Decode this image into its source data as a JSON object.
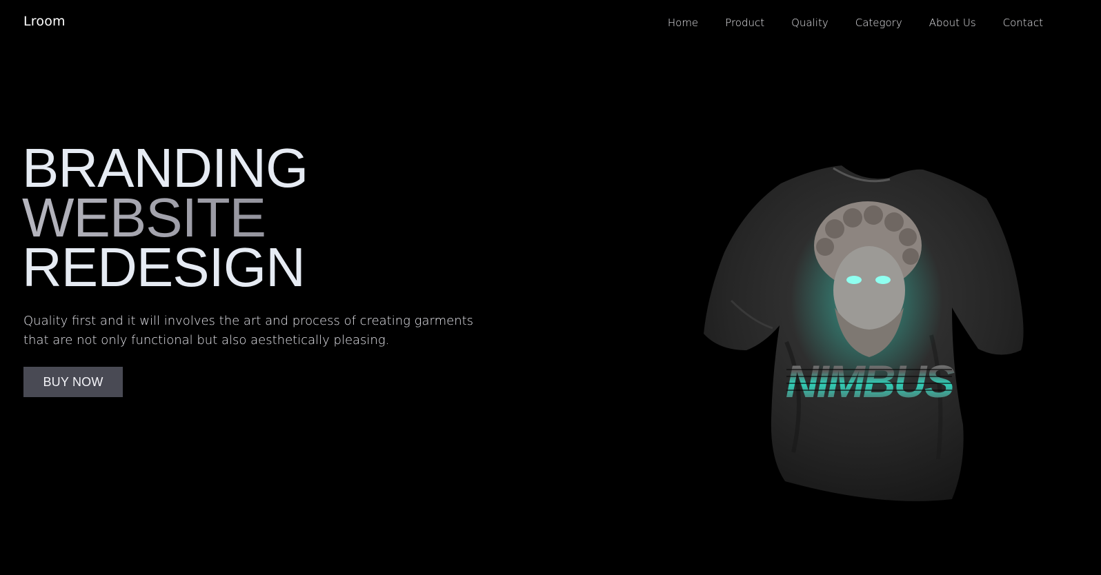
{
  "brand": {
    "logo_text": "Lroom"
  },
  "nav": {
    "items": [
      {
        "label": "Home"
      },
      {
        "label": "Product"
      },
      {
        "label": "Quality"
      },
      {
        "label": "Category"
      },
      {
        "label": "About Us"
      },
      {
        "label": "Contact"
      }
    ]
  },
  "hero": {
    "title_line1": "BRANDING",
    "title_line2": "WEBSITE",
    "title_line3": "REDESIGN",
    "description_line1": "Quality first and it will involves the art and process of creating garments",
    "description_line2": "that are not only functional but also aesthetically pleasing.",
    "cta_label": "BUY NOW"
  },
  "product_image": {
    "print_text": "NIMBUS"
  },
  "colors": {
    "background": "#000000",
    "text": "#e6ebf3",
    "button_bg": "#494a54",
    "shirt": "#2b2b2b",
    "accent_glow": "#2fe3c8"
  }
}
